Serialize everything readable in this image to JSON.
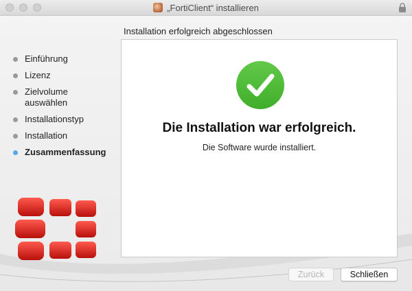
{
  "window": {
    "title": "„FortiClient“ installieren"
  },
  "heading": "Installation erfolgreich abgeschlossen",
  "sidebar": {
    "items": [
      {
        "label": "Einführung",
        "active": false
      },
      {
        "label": "Lizenz",
        "active": false
      },
      {
        "label": "Zielvolume auswählen",
        "active": false
      },
      {
        "label": "Installationstyp",
        "active": false
      },
      {
        "label": "Installation",
        "active": false
      },
      {
        "label": "Zusammenfassung",
        "active": true
      }
    ]
  },
  "content": {
    "title": "Die Installation war erfolgreich.",
    "subtitle": "Die Software wurde installiert."
  },
  "buttons": {
    "back_label": "Zurück",
    "close_label": "Schließen"
  },
  "colors": {
    "success_green": "#4cbb34",
    "active_step_blue": "#5aa7e8",
    "logo_red": "#e0201c"
  }
}
